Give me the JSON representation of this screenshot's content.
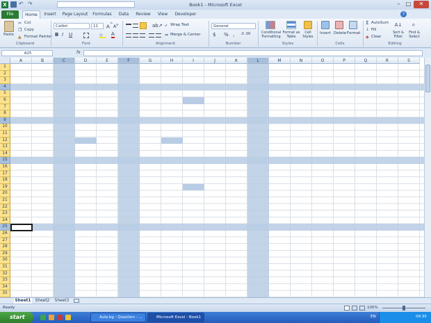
{
  "window": {
    "title": "Book1 - Microsoft Excel"
  },
  "tabs": [
    "File",
    "Home",
    "Insert",
    "Page Layout",
    "Formulas",
    "Data",
    "Review",
    "View",
    "Developer"
  ],
  "ribbon": {
    "clipboard": {
      "paste": "Paste",
      "cut": "Cut",
      "copy": "Copy",
      "format_painter": "Format Painter",
      "label": "Clipboard"
    },
    "font": {
      "name": "Calibri",
      "size": "11",
      "label": "Font"
    },
    "alignment": {
      "wrap": "Wrap Text",
      "merge": "Merge & Center",
      "label": "Alignment"
    },
    "number": {
      "format": "General",
      "label": "Number"
    },
    "styles": {
      "conditional": "Conditional Formatting",
      "format_table": "Format as Table",
      "cell_styles": "Cell Styles",
      "label": "Styles"
    },
    "cells": {
      "insert": "Insert",
      "delete": "Delete",
      "format": "Format",
      "label": "Cells"
    },
    "editing": {
      "autosum": "AutoSum",
      "fill": "Fill",
      "clear": "Clear",
      "sort": "Sort & Filter",
      "find": "Find & Select",
      "label": "Editing"
    }
  },
  "formula_bar": {
    "name_box": "A25",
    "fx": "fx",
    "value": ""
  },
  "columns": [
    "A",
    "B",
    "C",
    "D",
    "E",
    "F",
    "G",
    "H",
    "I",
    "J",
    "K",
    "L",
    "M",
    "N",
    "O",
    "P",
    "Q",
    "R",
    "S"
  ],
  "rows": [
    "1",
    "2",
    "3",
    "4",
    "5",
    "6",
    "7",
    "8",
    "9",
    "10",
    "11",
    "12",
    "13",
    "14",
    "15",
    "16",
    "17",
    "18",
    "19",
    "20",
    "21",
    "22",
    "23",
    "24",
    "25",
    "26",
    "27",
    "28",
    "29",
    "30",
    "31",
    "32",
    "33",
    "34",
    "35"
  ],
  "selected_columns": [
    "C",
    "F",
    "L"
  ],
  "selected_rows": [
    "4",
    "9",
    "15",
    "25"
  ],
  "highlighted_cells": [
    "I6",
    "D12",
    "H12",
    "I19"
  ],
  "active_cell": "A25",
  "sheets": [
    "Sheet1",
    "Sheet2",
    "Sheet3"
  ],
  "status": {
    "ready": "Ready",
    "zoom": "100%"
  },
  "taskbar": {
    "start": "start",
    "items": [
      "Aula.bg - Question - ...",
      "Microsoft Excel - Book1"
    ],
    "lang": "EN",
    "clock": "09:35"
  }
}
